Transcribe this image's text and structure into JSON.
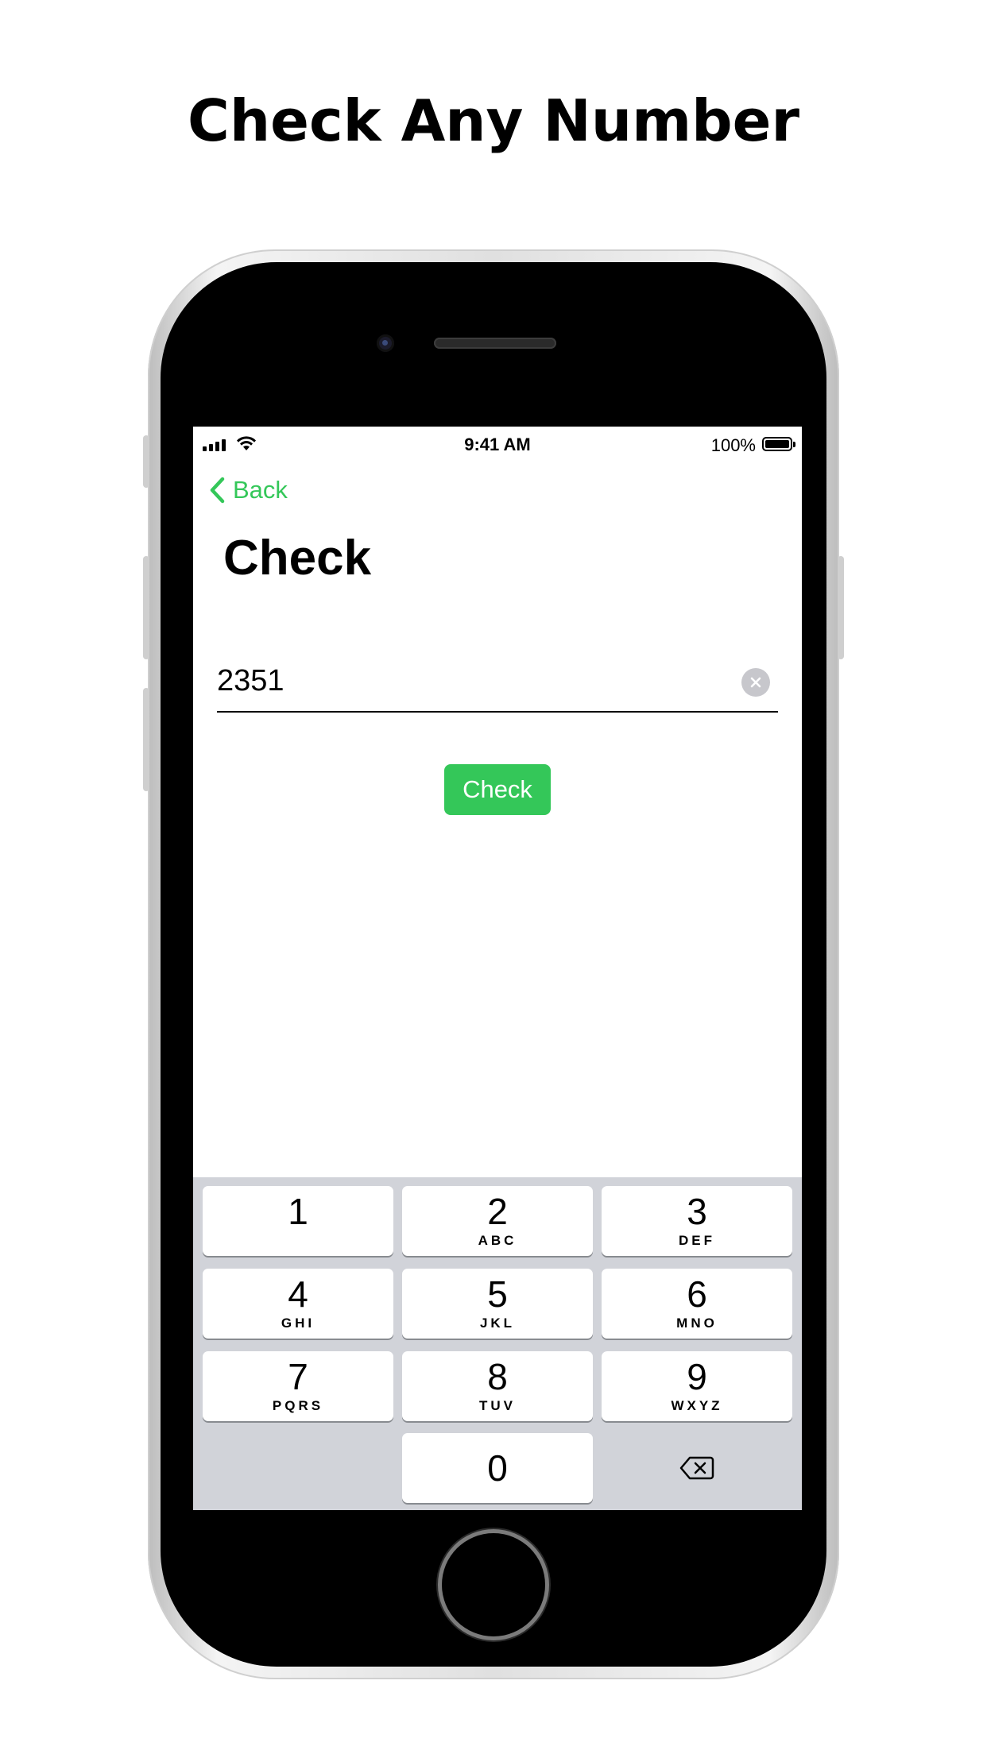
{
  "headline": "Check Any Number",
  "status_bar": {
    "time": "9:41 AM",
    "battery": "100%"
  },
  "nav": {
    "back_label": "Back"
  },
  "page_title": "Check",
  "number_field": {
    "value": "2351"
  },
  "check_button": "Check",
  "keypad": [
    {
      "num": "1",
      "letters": ""
    },
    {
      "num": "2",
      "letters": "ABC"
    },
    {
      "num": "3",
      "letters": "DEF"
    },
    {
      "num": "4",
      "letters": "GHI"
    },
    {
      "num": "5",
      "letters": "JKL"
    },
    {
      "num": "6",
      "letters": "MNO"
    },
    {
      "num": "7",
      "letters": "PQRS"
    },
    {
      "num": "8",
      "letters": "TUV"
    },
    {
      "num": "9",
      "letters": "WXYZ"
    },
    {
      "num": "0",
      "letters": ""
    }
  ],
  "colors": {
    "accent": "#34c759",
    "keyboard_bg": "#d1d3d9"
  }
}
